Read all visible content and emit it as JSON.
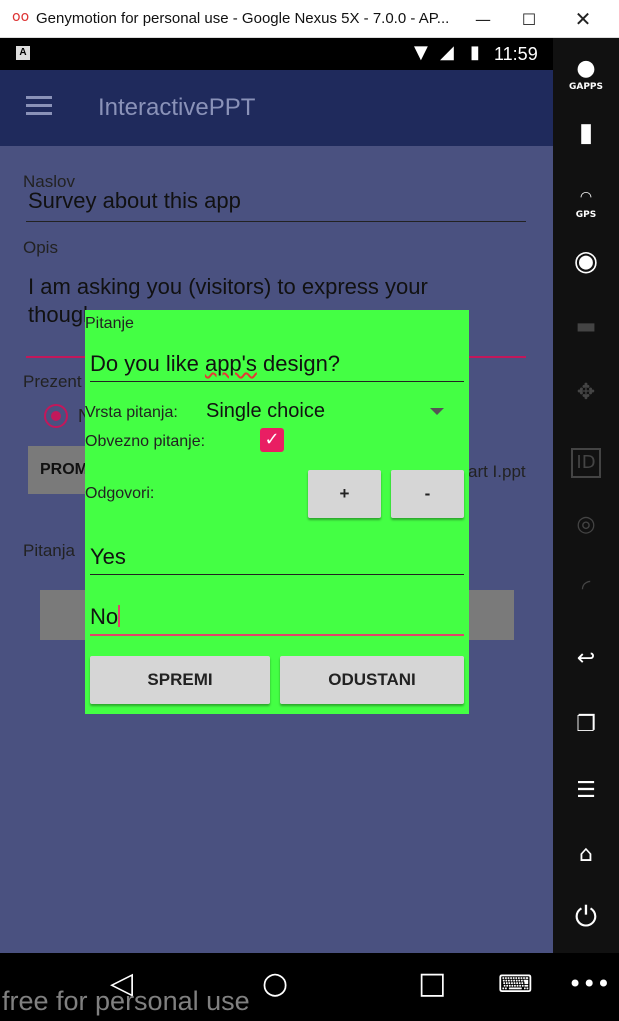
{
  "window": {
    "logo": "oo",
    "title": "Genymotion for personal use - Google Nexus 5X - 7.0.0 - AP...",
    "minimize_icon": "—",
    "maximize_icon": "☐",
    "close_icon": "✕"
  },
  "statusbar": {
    "time": "11:59",
    "notification_letter": "A"
  },
  "sidebar": {
    "gapps_label": "GAPPS",
    "gps_label": "GPS"
  },
  "appbar": {
    "title": "InteractivePPT"
  },
  "form": {
    "naslov_label": "Naslov",
    "naslov_value": "Survey about this app",
    "opis_label": "Opis",
    "opis_value_line1": "I am asking you (visitors) to express your",
    "opis_value_line2": "though",
    "prezent_label": "Prezent",
    "radio_label": "N",
    "prom_button": "PROM",
    "ppt_file": "art I.ppt",
    "pitanja_label": "Pitanja"
  },
  "dialog": {
    "pitanje_label": "Pitanje",
    "question_prefix": "Do you like ",
    "question_misspelled": "app's",
    "question_suffix": " design?",
    "vrsta_label": "Vrsta pitanja:",
    "vrsta_value": "Single choice",
    "obvezno_label": "Obvezno pitanje:",
    "obvezno_checked": true,
    "check_glyph": "✓",
    "odgovori_label": "Odgovori:",
    "add_button": "+",
    "remove_button": "-",
    "answers": [
      "Yes",
      "No"
    ],
    "save_button": "SPREMI",
    "cancel_button": "ODUSTANI"
  },
  "watermark": "free for personal use"
}
